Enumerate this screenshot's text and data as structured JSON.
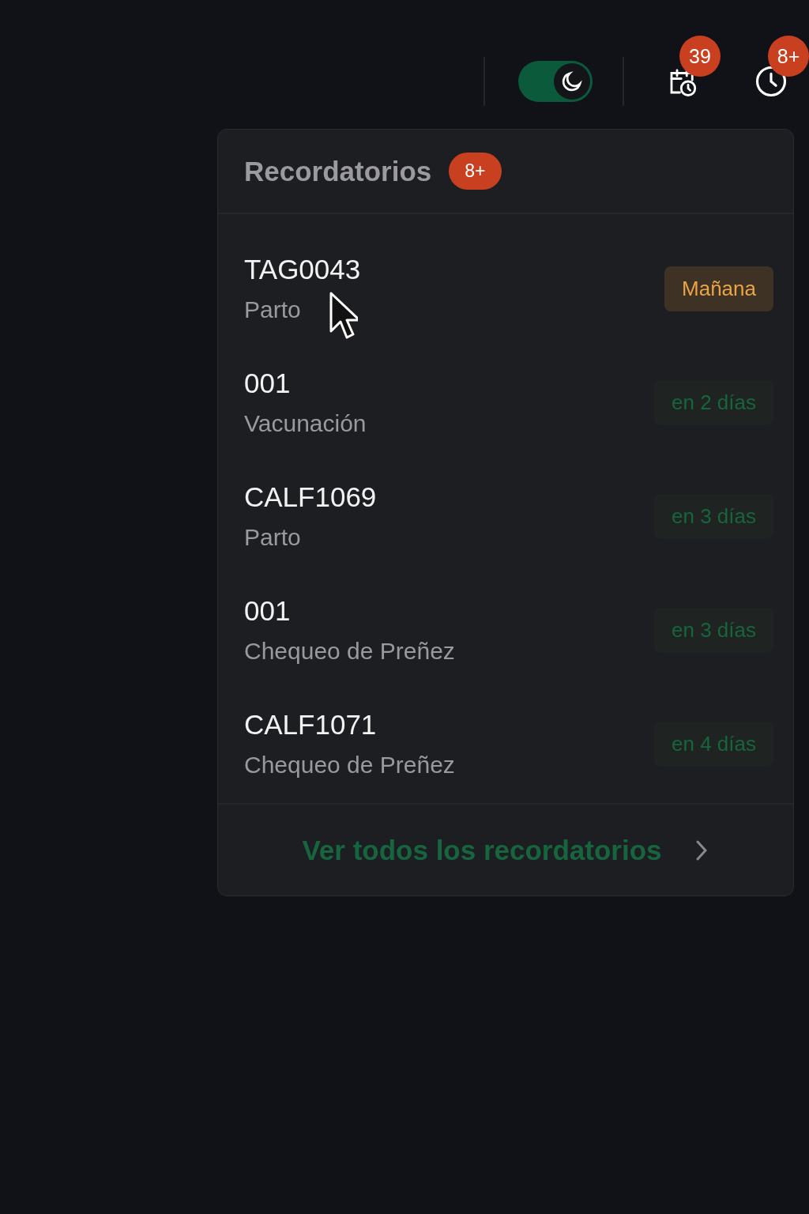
{
  "top_bar": {
    "dark_mode_toggle": {
      "on": true
    },
    "calendar_badge": "39",
    "clock_badge": "8+"
  },
  "reminders": {
    "title": "Recordatorios",
    "count": "8+",
    "items": [
      {
        "tag": "TAG0043",
        "event": "Parto",
        "due": "Mañana",
        "kind": "soon"
      },
      {
        "tag": "001",
        "event": "Vacunación",
        "due": "en 2 días",
        "kind": "later"
      },
      {
        "tag": "CALF1069",
        "event": "Parto",
        "due": "en 3 días",
        "kind": "later"
      },
      {
        "tag": "001",
        "event": "Chequeo de Preñez",
        "due": "en 3 días",
        "kind": "later"
      },
      {
        "tag": "CALF1071",
        "event": "Chequeo de Preñez",
        "due": "en 4 días",
        "kind": "later"
      }
    ],
    "footer_link": "Ver todos los recordatorios"
  }
}
